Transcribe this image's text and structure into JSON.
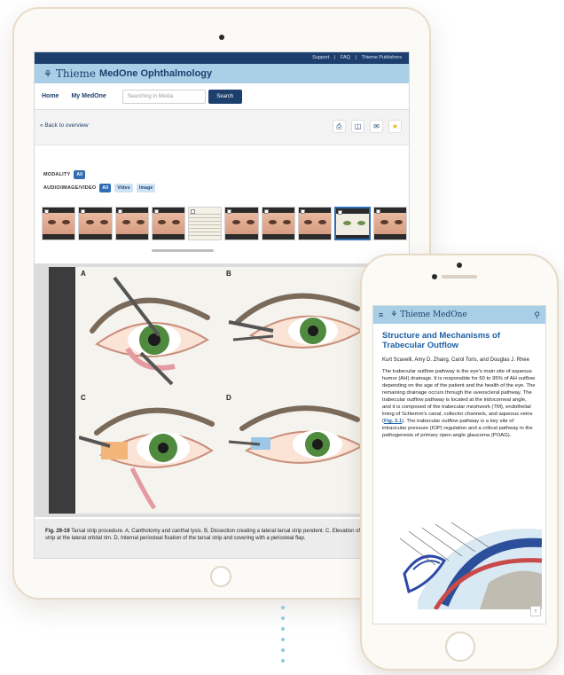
{
  "tablet": {
    "topbar": {
      "support": "Support",
      "faq": "FAQ",
      "publishers": "Thieme Publishers",
      "sep": "|"
    },
    "brand": {
      "name": "Thieme",
      "product": "MedOne Ophthalmology"
    },
    "nav": {
      "home": "Home",
      "my_medone": "My MedOne",
      "search_placeholder": "Searching in Media",
      "search_button": "Search"
    },
    "back_link": "« Back to overview",
    "tool_icons": [
      "print-icon",
      "document-icon",
      "comment-icon",
      "star-icon"
    ],
    "filters": {
      "modality_label": "MODALITY",
      "modality_chip": "All",
      "media_label": "AUDIO/IMAGE/VIDEO",
      "media_chips": [
        "All",
        "Video",
        "Image"
      ]
    },
    "figure": {
      "panel_letters": [
        "A",
        "B",
        "C",
        "D"
      ],
      "caption_label": "Fig. 29-19",
      "caption_text": "Tarsal strip procedure. A, Canthotomy and canthal lysis. B, Dissection creating a lateral tarsal strip pendent. C, Elevation of a periosteal strip at the lateral orbital rim. D, Internal periosteal fixation of the tarsal strip and covering with a periosteal flap."
    }
  },
  "phone": {
    "brand": {
      "name": "Thieme",
      "product": "MedOne"
    },
    "title": "Structure and Mechanisms of Trabecular Outflow",
    "authors": "Kurt Scavelli, Amy D. Zhang, Carol Toris, and Douglas J. Rhee",
    "body_before_link": "The trabecular outflow pathway is the eye's main site of aqueous humor (AH) drainage. It is responsible for 60 to 95% of AH outflow depending on the age of the patient and the health of the eye. The remaining drainage occurs through the uveoscleral pathway. The trabecular outflow pathway is located at the iridocorneal angle, and it is composed of the trabecular meshwork (TM), endothelial lining of Schlemm's canal, collector channels, and aqueous veins (",
    "link": "Fig. 2.1",
    "body_after_link": "). The trabecular outflow pathway is a key site of intraocular pressure (IOP) regulation and a critical pathway in the pathogenesis of primary open-angle glaucoma (POAG)."
  },
  "colors": {
    "navy": "#1d3f6e",
    "light_blue": "#a9cfe6",
    "accent_blue": "#2f6db5",
    "link_blue": "#1d5fa3"
  }
}
